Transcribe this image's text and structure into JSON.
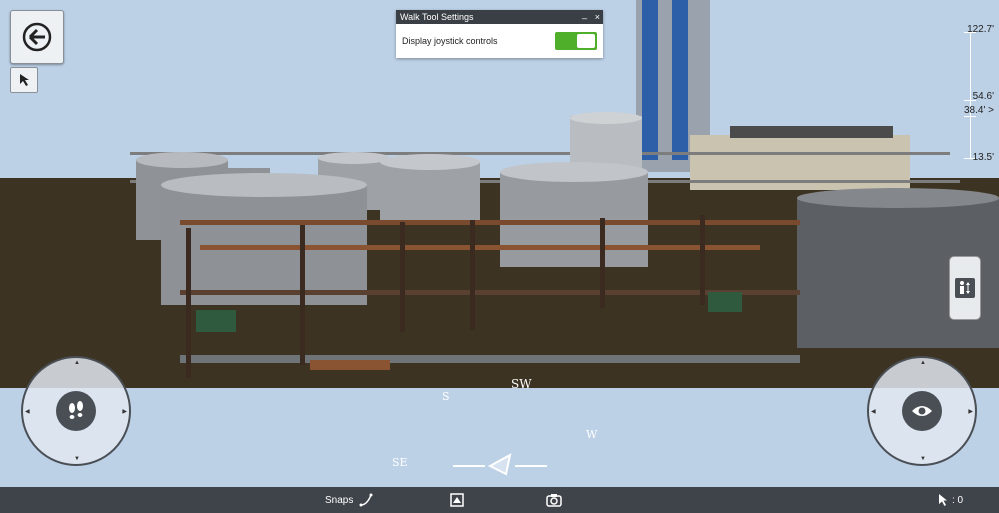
{
  "settings_panel": {
    "title": "Walk Tool Settings",
    "minimize_label": "_",
    "close_label": "×",
    "joystick_label": "Display joystick controls",
    "joystick_on": true
  },
  "elevation_ruler": {
    "labels": [
      "122.7'",
      "54.6'",
      "38.4' >",
      "13.5'"
    ]
  },
  "compass": {
    "labels": [
      "SW",
      "S",
      "W",
      "SE"
    ]
  },
  "bottom_bar": {
    "snaps_label": "Snaps",
    "selection_count": ": 0"
  },
  "icons": {
    "back": "back-arrow-icon",
    "select": "cursor-icon",
    "walk": "footprints-icon",
    "look": "eye-icon",
    "elevation": "people-elevation-icon",
    "snaps": "snap-icon",
    "view": "view-icon",
    "camera": "camera-icon",
    "pointer": "pointer-icon"
  }
}
